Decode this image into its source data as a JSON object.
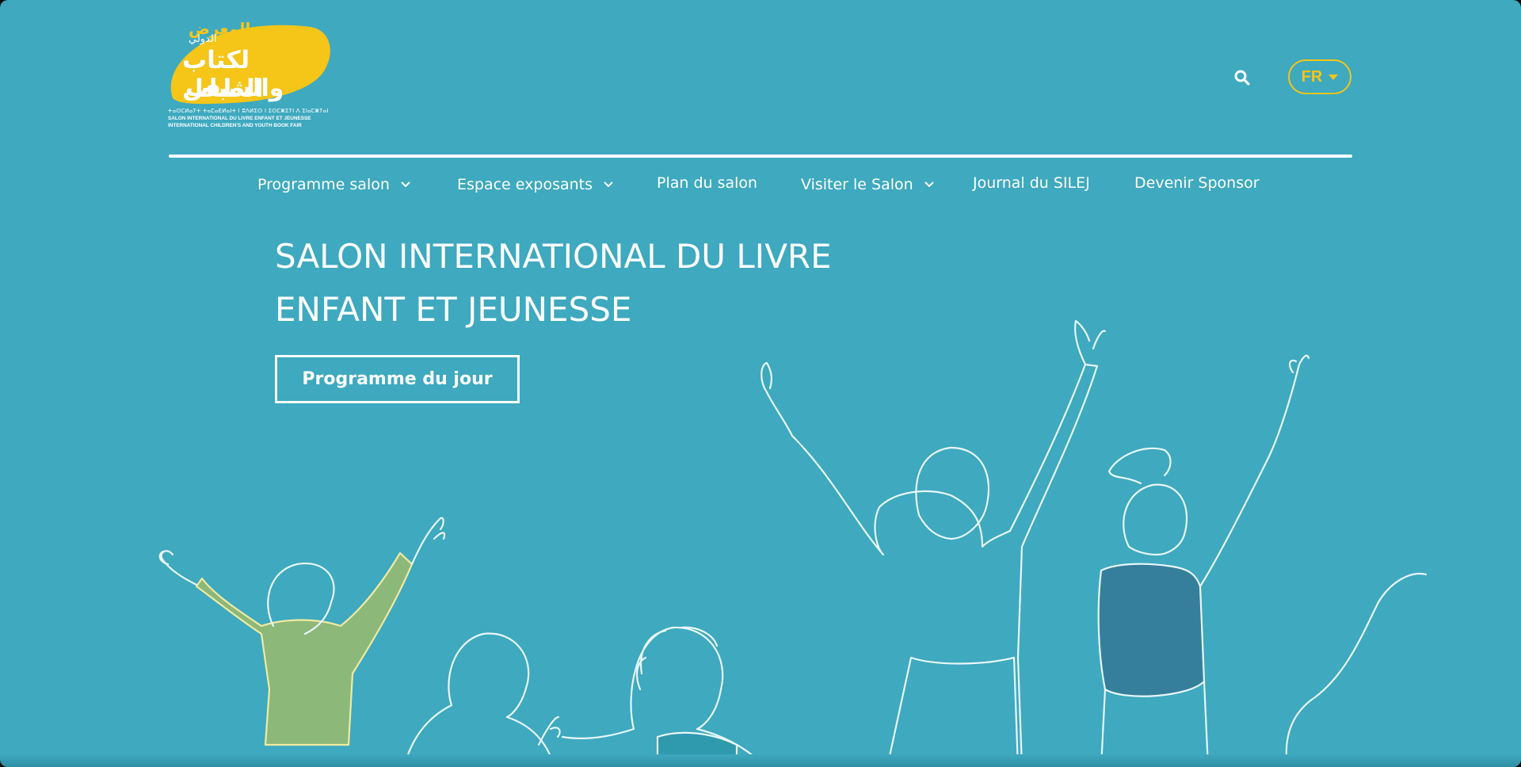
{
  "header": {
    "logo": {
      "arabic_line1": "المعرض",
      "arabic_line2": "الدولي",
      "arabic_line3": "لكتاب الطفل",
      "arabic_line4": "والشباب",
      "tifinagh": "ⵜⴰⵙⵎⵍⴰⵢⵜ ⵜⴰⵎⴰⴹⵍⴰⵏⵜ ⵏ ⵓⴷⵍⵉⵙ ⵏ ⵉⵙⵎⵥⵉⵢⵏ ⴷ ⵉⵏⴰⵎⵥⵢⴰⵏ",
      "french": "SALON INTERNATIONAL DU LIVRE ENFANT ET JEUNESSE",
      "english": "INTERNATIONAL CHILDREN'S AND YOUTH BOOK FAIR"
    },
    "search_icon": "search-icon",
    "language": "FR"
  },
  "nav": {
    "items": [
      {
        "label": "Programme salon",
        "has_dropdown": true
      },
      {
        "label": "Espace exposants",
        "has_dropdown": true
      },
      {
        "label": "Plan du salon",
        "has_dropdown": false
      },
      {
        "label": "Visiter le Salon",
        "has_dropdown": true
      },
      {
        "label": "Journal du SILEJ",
        "has_dropdown": false
      },
      {
        "label": "Devenir Sponsor",
        "has_dropdown": false
      }
    ]
  },
  "hero": {
    "title_line1": "SALON INTERNATIONAL DU LIVRE",
    "title_line2": "ENFANT ET JEUNESSE",
    "cta_label": "Programme du jour"
  },
  "colors": {
    "background": "#3ea9bf",
    "accent_yellow": "#f5c518",
    "line_white": "#ffffff",
    "shirt_green": "#8cb87a",
    "shirt_blue": "#357f9c"
  }
}
